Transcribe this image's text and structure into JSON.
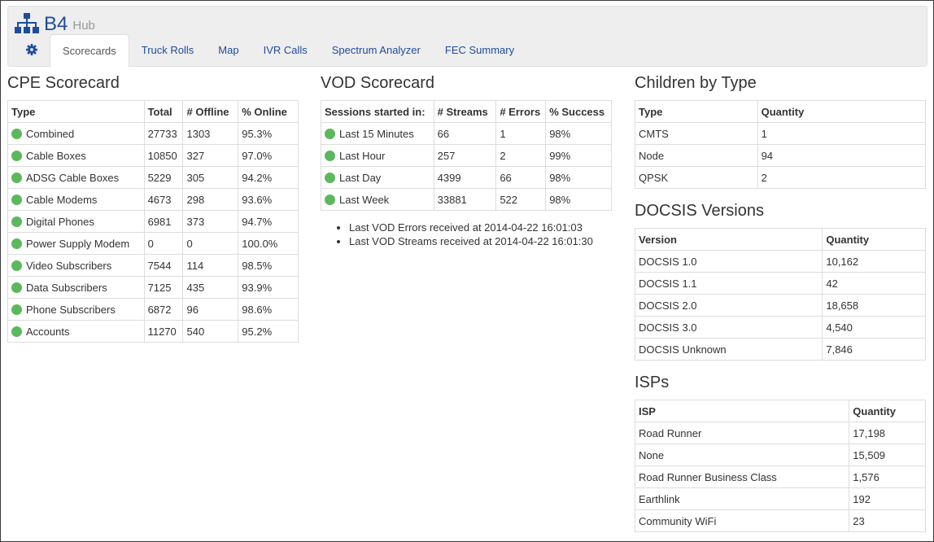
{
  "app": {
    "title": "B4",
    "subtitle": "Hub",
    "brand_color": "#1e4c9a",
    "status_color": "#5cb85c"
  },
  "tabs": [
    {
      "label": "Scorecards",
      "active": true
    },
    {
      "label": "Truck Rolls"
    },
    {
      "label": "Map"
    },
    {
      "label": "IVR Calls"
    },
    {
      "label": "Spectrum Analyzer"
    },
    {
      "label": "FEC Summary"
    }
  ],
  "cpe": {
    "title": "CPE Scorecard",
    "headers": [
      "Type",
      "Total",
      "# Offline",
      "% Online"
    ],
    "rows": [
      [
        "Combined",
        "27733",
        "1303",
        "95.3%"
      ],
      [
        "Cable Boxes",
        "10850",
        "327",
        "97.0%"
      ],
      [
        "ADSG Cable Boxes",
        "5229",
        "305",
        "94.2%"
      ],
      [
        "Cable Modems",
        "4673",
        "298",
        "93.6%"
      ],
      [
        "Digital Phones",
        "6981",
        "373",
        "94.7%"
      ],
      [
        "Power Supply Modem",
        "0",
        "0",
        "100.0%"
      ],
      [
        "Video Subscribers",
        "7544",
        "114",
        "98.5%"
      ],
      [
        "Data Subscribers",
        "7125",
        "435",
        "93.9%"
      ],
      [
        "Phone Subscribers",
        "6872",
        "96",
        "98.6%"
      ],
      [
        "Accounts",
        "11270",
        "540",
        "95.2%"
      ]
    ]
  },
  "vod": {
    "title": "VOD Scorecard",
    "headers": [
      "Sessions started in:",
      "# Streams",
      "# Errors",
      "% Success"
    ],
    "rows": [
      [
        "Last 15 Minutes",
        "66",
        "1",
        "98%"
      ],
      [
        "Last Hour",
        "257",
        "2",
        "99%"
      ],
      [
        "Last Day",
        "4399",
        "66",
        "98%"
      ],
      [
        "Last Week",
        "33881",
        "522",
        "98%"
      ]
    ],
    "notes": [
      "Last VOD Errors received at 2014-04-22 16:01:03",
      "Last VOD Streams received at 2014-04-22 16:01:30"
    ]
  },
  "children": {
    "title": "Children by Type",
    "headers": [
      "Type",
      "Quantity"
    ],
    "rows": [
      [
        "CMTS",
        "1"
      ],
      [
        "Node",
        "94"
      ],
      [
        "QPSK",
        "2"
      ]
    ]
  },
  "docsis": {
    "title": "DOCSIS Versions",
    "headers": [
      "Version",
      "Quantity"
    ],
    "rows": [
      [
        "DOCSIS 1.0",
        "10,162"
      ],
      [
        "DOCSIS 1.1",
        "42"
      ],
      [
        "DOCSIS 2.0",
        "18,658"
      ],
      [
        "DOCSIS 3.0",
        "4,540"
      ],
      [
        "DOCSIS Unknown",
        "7,846"
      ]
    ]
  },
  "isps": {
    "title": "ISPs",
    "headers": [
      "ISP",
      "Quantity"
    ],
    "rows": [
      [
        "Road Runner",
        "17,198"
      ],
      [
        "None",
        "15,509"
      ],
      [
        "Road Runner Business Class",
        "1,576"
      ],
      [
        "Earthlink",
        "192"
      ],
      [
        "Community WiFi",
        "23"
      ]
    ]
  }
}
